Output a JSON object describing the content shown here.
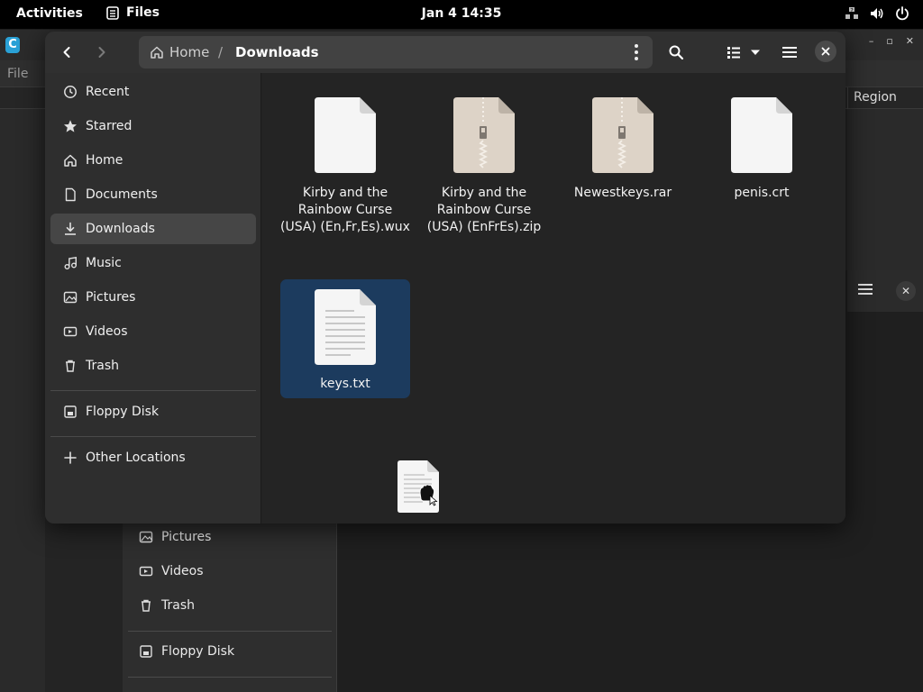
{
  "topbar": {
    "activities": "Activities",
    "app_name": "Files",
    "clock": "Jan 4  14:35",
    "tray_icons": [
      "network-icon",
      "volume-icon",
      "power-icon"
    ]
  },
  "background_window": {
    "menu_file": "File",
    "column_region": "Region"
  },
  "background_sidebar": {
    "items": [
      {
        "label": "Pictures",
        "icon": "pictures-icon"
      },
      {
        "label": "Videos",
        "icon": "videos-icon"
      },
      {
        "label": "Trash",
        "icon": "trash-icon"
      },
      {
        "label": "Floppy Disk",
        "icon": "floppy-icon"
      }
    ]
  },
  "files_window": {
    "path": {
      "home": "Home",
      "separator": "/",
      "current": "Downloads"
    },
    "sidebar": {
      "items": [
        {
          "label": "Recent",
          "icon": "clock-icon"
        },
        {
          "label": "Starred",
          "icon": "star-icon"
        },
        {
          "label": "Home",
          "icon": "home-icon"
        },
        {
          "label": "Documents",
          "icon": "document-icon"
        },
        {
          "label": "Downloads",
          "icon": "download-icon",
          "active": true
        },
        {
          "label": "Music",
          "icon": "music-icon"
        },
        {
          "label": "Pictures",
          "icon": "pictures-icon"
        },
        {
          "label": "Videos",
          "icon": "videos-icon"
        },
        {
          "label": "Trash",
          "icon": "trash-icon"
        }
      ],
      "devices": [
        {
          "label": "Floppy Disk",
          "icon": "floppy-icon"
        }
      ],
      "other": {
        "label": "Other Locations",
        "icon": "plus-icon"
      }
    },
    "files": [
      {
        "name_lines": [
          "Kirby and the",
          "Rainbow Curse",
          "(USA) (En,Fr,Es).wux"
        ],
        "type": "generic"
      },
      {
        "name_lines": [
          "Kirby and the",
          "Rainbow Curse",
          "(USA) (EnFrEs).zip"
        ],
        "type": "archive"
      },
      {
        "name_lines": [
          "Newestkeys.rar"
        ],
        "type": "archive"
      },
      {
        "name_lines": [
          "penis.crt"
        ],
        "type": "generic"
      },
      {
        "name_lines": [
          "keys.txt"
        ],
        "type": "text",
        "selected": true
      }
    ]
  },
  "colors": {
    "selection": "#1c3b5e",
    "sidebar_active": "#464646",
    "window_bg": "#242424",
    "headerbar": "#303030"
  }
}
